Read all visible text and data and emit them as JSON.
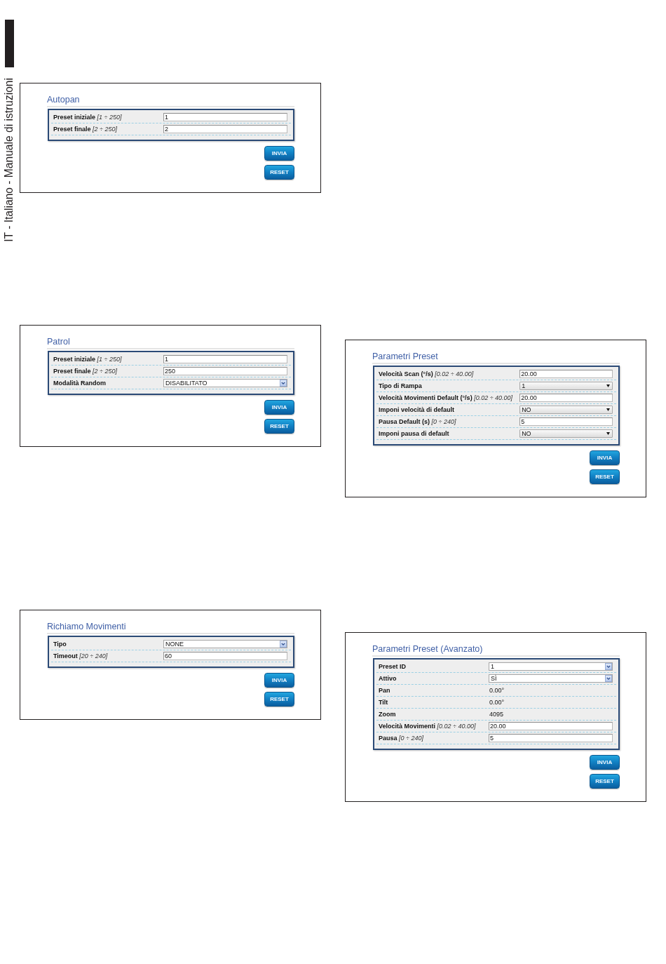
{
  "side": {
    "label": "IT - Italiano - Manuale di istruzioni"
  },
  "left_column": [
    {
      "title": "Autopan",
      "rows": [
        {
          "kind": "input",
          "label": "Preset iniziale",
          "range": "[1 ÷ 250]",
          "value": "1"
        },
        {
          "kind": "input",
          "label": "Preset finale",
          "range": "[2 ÷ 250]",
          "value": "2"
        }
      ],
      "buttons": [
        "INVIA",
        "RESET"
      ]
    },
    {
      "title": "Patrol",
      "rows": [
        {
          "kind": "input",
          "label": "Preset iniziale",
          "range": "[1 ÷ 250]",
          "value": "1"
        },
        {
          "kind": "input",
          "label": "Preset finale",
          "range": "[2 ÷ 250]",
          "value": "250"
        },
        {
          "kind": "combo",
          "label": "Modalità Random",
          "value": "DISABILITATO"
        }
      ],
      "buttons": [
        "INVIA",
        "RESET"
      ]
    },
    {
      "title": "Richiamo Movimenti",
      "rows": [
        {
          "kind": "combo",
          "label": "Tipo",
          "value": "NONE"
        },
        {
          "kind": "input",
          "label": "Timeout",
          "range": "[20 ÷ 240]",
          "value": "60"
        }
      ],
      "buttons": [
        "INVIA",
        "RESET"
      ]
    }
  ],
  "right_column": [
    {
      "title": "Parametri Preset",
      "rows": [
        {
          "kind": "input",
          "label": "Velocità Scan (°/s)",
          "range": "[0.02 ÷ 40.00]",
          "value": "20.00"
        },
        {
          "kind": "select",
          "label": "Tipo di Rampa",
          "value": "1"
        },
        {
          "kind": "input",
          "label": "Velocità Movimenti Default (°/s)",
          "range": "[0.02 ÷ 40.00]",
          "value": "20.00"
        },
        {
          "kind": "select",
          "label": "Imponi velocità di default",
          "value": "NO"
        },
        {
          "kind": "input",
          "label": "Pausa Default (s)",
          "range": "[0 ÷ 240]",
          "value": "5"
        },
        {
          "kind": "select",
          "label": "Imponi pausa di default",
          "value": "NO"
        }
      ],
      "buttons": [
        "INVIA",
        "RESET"
      ]
    },
    {
      "title": "Parametri Preset (Avanzato)",
      "rows": [
        {
          "kind": "combo",
          "label": "Preset ID",
          "value": "1"
        },
        {
          "kind": "combo",
          "label": "Attivo",
          "value": "SÌ"
        },
        {
          "kind": "text",
          "label": "Pan",
          "value": "0.00°"
        },
        {
          "kind": "text",
          "label": "Tilt",
          "value": "0.00°"
        },
        {
          "kind": "text",
          "label": "Zoom",
          "value": "4095"
        },
        {
          "kind": "input",
          "label": "Velocità Movimenti",
          "range": "[0.02 ÷ 40.00]",
          "value": "20.00"
        },
        {
          "kind": "input",
          "label": "Pausa",
          "range": "[0 ÷ 240]",
          "value": "5"
        }
      ],
      "buttons": [
        "INVIA",
        "RESET"
      ]
    }
  ]
}
